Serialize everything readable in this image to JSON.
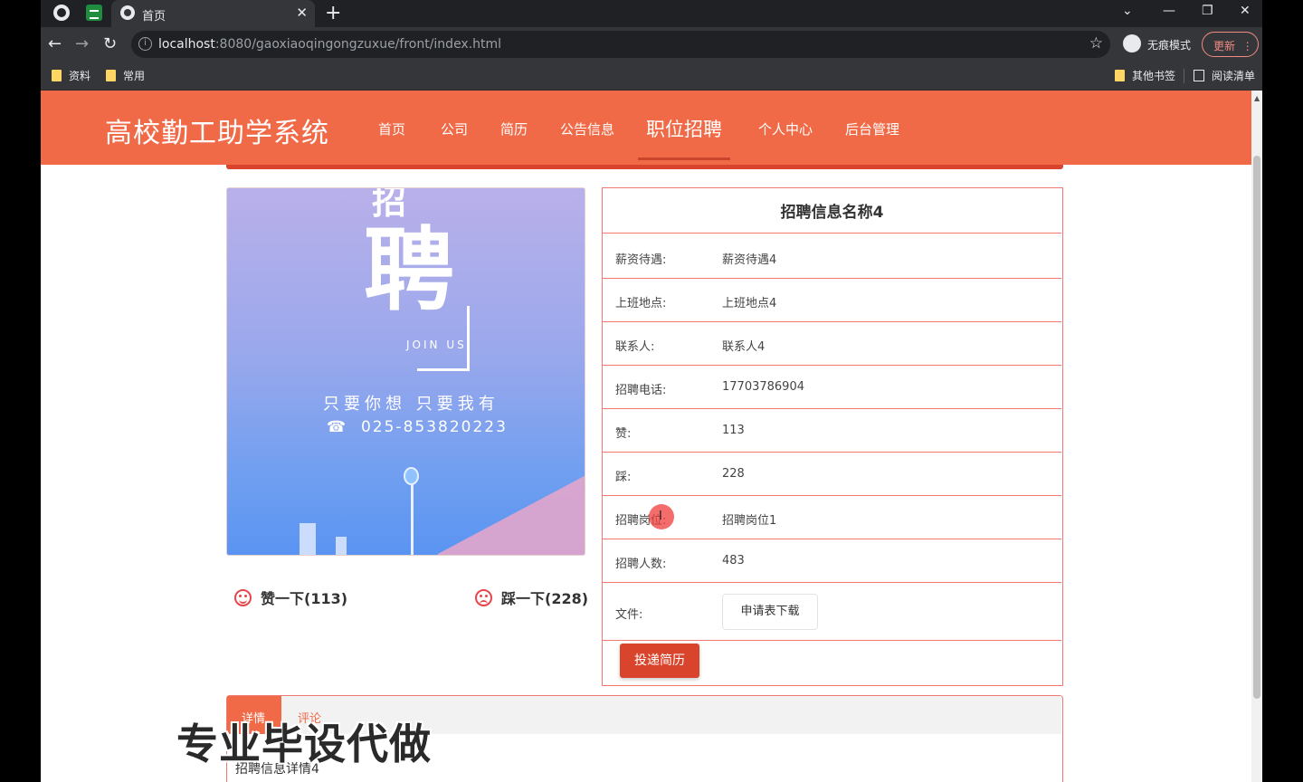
{
  "browser": {
    "tab_title": "首页",
    "url_host": "localhost",
    "url_path": ":8080/gaoxiaoqingongzuxue/front/index.html",
    "incognito_label": "无痕模式",
    "update_label": "更新",
    "bookmarks": [
      "资料",
      "常用"
    ],
    "bookmarks_right": [
      "其他书签",
      "阅读清单"
    ]
  },
  "site": {
    "title": "高校勤工助学系统",
    "nav": [
      "首页",
      "公司",
      "简历",
      "公告信息",
      "职位招聘",
      "个人中心",
      "后台管理"
    ],
    "active_nav": "职位招聘"
  },
  "poster": {
    "top_char": "招",
    "big_char": "聘",
    "join": "JOIN US",
    "slogan": "只要你想 只要我有",
    "phone_icon": "phone-icon",
    "phone": "025-853820223"
  },
  "votes": {
    "like": "赞一下(113)",
    "dislike": "踩一下(228)"
  },
  "job": {
    "title": "招聘信息名称4",
    "rows": [
      {
        "label": "薪资待遇:",
        "value": "薪资待遇4"
      },
      {
        "label": "上班地点:",
        "value": "上班地点4"
      },
      {
        "label": "联系人:",
        "value": "联系人4"
      },
      {
        "label": "招聘电话:",
        "value": "17703786904"
      },
      {
        "label": "赞:",
        "value": "113"
      },
      {
        "label": "踩:",
        "value": "228"
      },
      {
        "label": "招聘岗位:",
        "value": "招聘岗位1"
      },
      {
        "label": "招聘人数:",
        "value": "483"
      }
    ],
    "file_label": "文件:",
    "download_label": "申请表下载",
    "submit_label": "投递简历"
  },
  "detail": {
    "tabs": [
      "详情",
      "评论"
    ],
    "text": "招聘信息详情4"
  },
  "watermark": "专业毕设代做",
  "colors": {
    "header": "#f16a47",
    "accent_dark": "#d9452c",
    "border": "#f07a72"
  }
}
